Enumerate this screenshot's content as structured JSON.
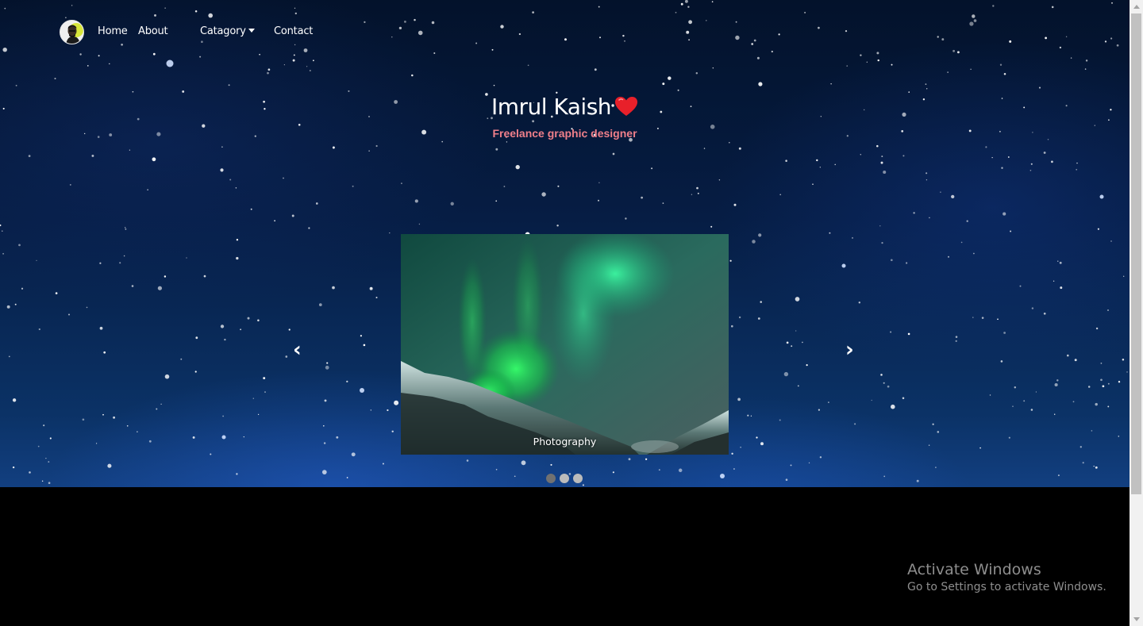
{
  "nav": {
    "logo_alt": "avatar",
    "home": "Home",
    "about": "About",
    "category": "Catagory",
    "contact": "Contact"
  },
  "hero": {
    "name": "Imrul Kaish",
    "tagline": "Freelance graphic designer"
  },
  "slider": {
    "caption": "Photography",
    "prev": "‹",
    "next": "›",
    "dot_count": 3,
    "active_dot": 1
  },
  "overlay": {
    "activate_title": "Activate Windows",
    "activate_sub": "Go to Settings to activate Windows."
  },
  "colors": {
    "tagline": "#ef7f8a",
    "heart": "#e8202a",
    "footer_bg": "#000000"
  }
}
